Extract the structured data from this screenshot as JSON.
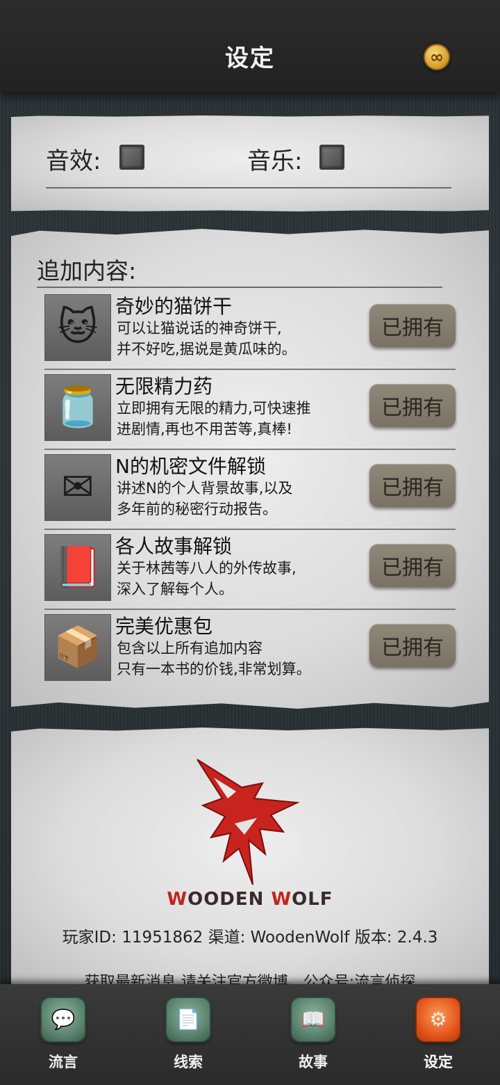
{
  "header": {
    "title": "设定",
    "coin_icon": "infinity-coin-icon",
    "coin_symbol": "∞"
  },
  "settings": {
    "sound_label": "音效:",
    "music_label": "音乐:",
    "sound_enabled": false,
    "music_enabled": false
  },
  "addons": {
    "title": "追加内容:",
    "items": [
      {
        "name": "奇妙的猫饼干",
        "desc1": "可以让猫说话的神奇饼干,",
        "desc2": "并不好吃,据说是黄瓜味的。",
        "button": "已拥有",
        "icon": "cat-cookie-icon",
        "glyph": "🐱"
      },
      {
        "name": "无限精力药",
        "desc1": "立即拥有无限的精力,可快速推",
        "desc2": "进剧情,再也不用苦等,真棒!",
        "button": "已拥有",
        "icon": "energy-jar-icon",
        "glyph": "🫙"
      },
      {
        "name": "N的机密文件解锁",
        "desc1": "讲述N的个人背景故事,以及",
        "desc2": "多年前的秘密行动报告。",
        "button": "已拥有",
        "icon": "secret-envelope-icon",
        "glyph": "✉"
      },
      {
        "name": "各人故事解锁",
        "desc1": "关于林茜等八人的外传故事,",
        "desc2": "深入了解每个人。",
        "button": "已拥有",
        "icon": "story-book-icon",
        "glyph": "📕"
      },
      {
        "name": "完美优惠包",
        "desc1": "包含以上所有追加内容",
        "desc2": "只有一本书的价钱,非常划算。",
        "button": "已拥有",
        "icon": "discount-box-icon",
        "glyph": "📦"
      }
    ]
  },
  "about": {
    "brand_w1": "W",
    "brand_rest1": "OODEN ",
    "brand_w2": "W",
    "brand_rest2": "OLF",
    "info": "玩家ID: 11951862 渠道: WoodenWolf 版本: 2.4.3",
    "news": "获取最新消息,请关注官方微博、公众号:流言侦探"
  },
  "nav": {
    "items": [
      {
        "label": "流言",
        "icon": "chat-bubble-icon",
        "glyph": "💬"
      },
      {
        "label": "线索",
        "icon": "clue-paper-icon",
        "glyph": "📄"
      },
      {
        "label": "故事",
        "icon": "story-book-icon",
        "glyph": "📖"
      },
      {
        "label": "设定",
        "icon": "settings-gear-icon",
        "glyph": "⚙"
      }
    ],
    "active": "设定"
  },
  "colors": {
    "accent_red": "#c0251f",
    "button_bg": "#857d6e",
    "nav_active": "#e4571c",
    "nav_icon": "#5b8470"
  }
}
